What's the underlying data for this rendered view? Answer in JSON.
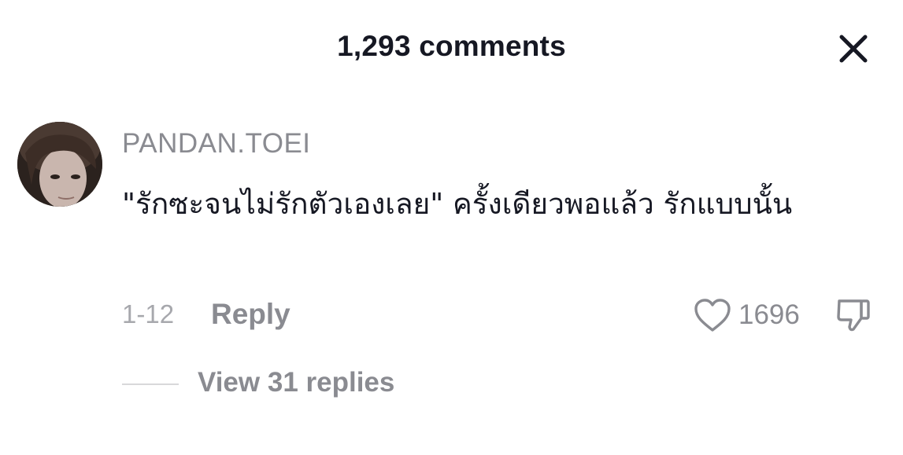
{
  "header": {
    "title": "1,293 comments"
  },
  "comment": {
    "username": "PANDAN.TOEI",
    "text": "\"รักซะจนไม่รักตัวเองเลย\" ครั้งเดียวพอแล้ว รักแบบนั้น",
    "date": "1-12",
    "reply_label": "Reply",
    "like_count": "1696",
    "view_replies_label": "View 31 replies"
  },
  "icons": {
    "close": "close-icon",
    "like": "heart-icon",
    "dislike": "thumbs-down-icon",
    "avatar": "avatar"
  },
  "colors": {
    "primary_text": "#161823",
    "secondary_text": "#8a8b91",
    "tertiary_text": "#a7a8ad",
    "background": "#ffffff"
  }
}
